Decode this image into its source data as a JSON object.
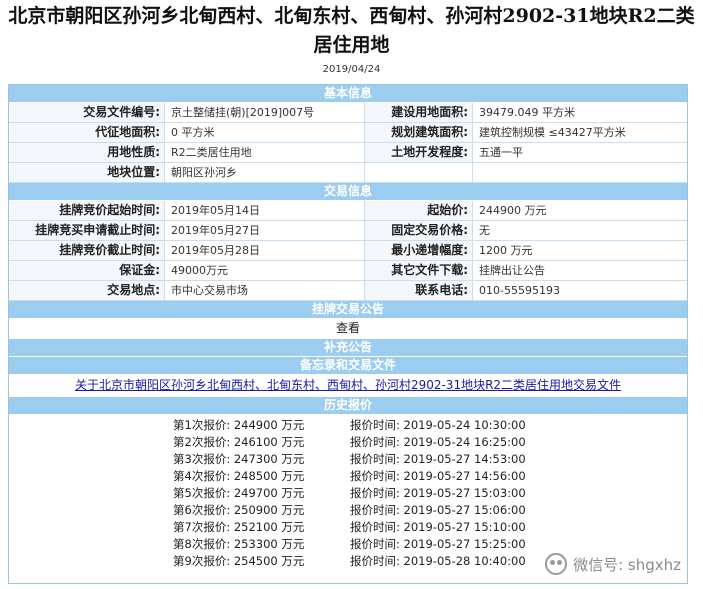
{
  "title_line1": "北京市朝阳区孙河乡北甸西村、北甸东村、西甸村、孙河村2902-31地块R2二类",
  "title_line2": "居住用地",
  "date": "2019/04/24",
  "sections": {
    "basic": "基本信息",
    "trade": "交易信息",
    "listing_notice": "挂牌交易公告",
    "supplement": "补充公告",
    "memo": "备忘录和交易文件",
    "history": "历史报价"
  },
  "basic_rows": [
    {
      "l1": "交易文件编号:",
      "v1": "京土整储挂(朝)[2019]007号",
      "l2": "建设用地面积:",
      "v2": "39479.049 平方米"
    },
    {
      "l1": "代征地面积:",
      "v1": "0 平方米",
      "l2": "规划建筑面积:",
      "v2": "建筑控制规模 ≤43427平方米"
    },
    {
      "l1": "用地性质:",
      "v1": "R2二类居住用地",
      "l2": "土地开发程度:",
      "v2": "五通一平"
    },
    {
      "l1": "地块位置:",
      "v1": "朝阳区孙河乡",
      "l2": "",
      "v2": ""
    }
  ],
  "trade_rows": [
    {
      "l1": "挂牌竞价起始时间:",
      "v1": "2019年05月14日",
      "l2": "起始价:",
      "v2": "244900 万元"
    },
    {
      "l1": "挂牌竞买申请截止时间:",
      "v1": "2019年05月27日",
      "l2": "固定交易价格:",
      "v2": "无"
    },
    {
      "l1": "挂牌竞价截止时间:",
      "v1": "2019年05月28日",
      "l2": "最小递增幅度:",
      "v2": "1200 万元"
    },
    {
      "l1": "保证金:",
      "v1": "49000万元",
      "l2": "其它文件下载:",
      "v2": "挂牌出让公告"
    },
    {
      "l1": "交易地点:",
      "v1": "市中心交易市场",
      "l2": "联系电话:",
      "v2": "010-55595193"
    }
  ],
  "view_link": "查看",
  "doc_link": "关于北京市朝阳区孙河乡北甸西村、北甸东村、西甸村、孙河村2902-31地块R2二类居住用地交易文件",
  "history": [
    {
      "bid": "第1次报价: 244900 万元",
      "time": "报价时间: 2019-05-24 10:30:00"
    },
    {
      "bid": "第2次报价: 246100 万元",
      "time": "报价时间: 2019-05-24 16:25:00"
    },
    {
      "bid": "第3次报价: 247300 万元",
      "time": "报价时间: 2019-05-27 14:53:00"
    },
    {
      "bid": "第4次报价: 248500 万元",
      "time": "报价时间: 2019-05-27 14:56:00"
    },
    {
      "bid": "第5次报价: 249700 万元",
      "time": "报价时间: 2019-05-27 15:03:00"
    },
    {
      "bid": "第6次报价: 250900 万元",
      "time": "报价时间: 2019-05-27 15:06:00"
    },
    {
      "bid": "第7次报价: 252100 万元",
      "time": "报价时间: 2019-05-27 15:10:00"
    },
    {
      "bid": "第8次报价: 253300 万元",
      "time": "报价时间: 2019-05-27 15:25:00"
    },
    {
      "bid": "第9次报价: 254500 万元",
      "time": "报价时间: 2019-05-28 10:40:00"
    }
  ],
  "watermark": "微信号: shgxhz"
}
